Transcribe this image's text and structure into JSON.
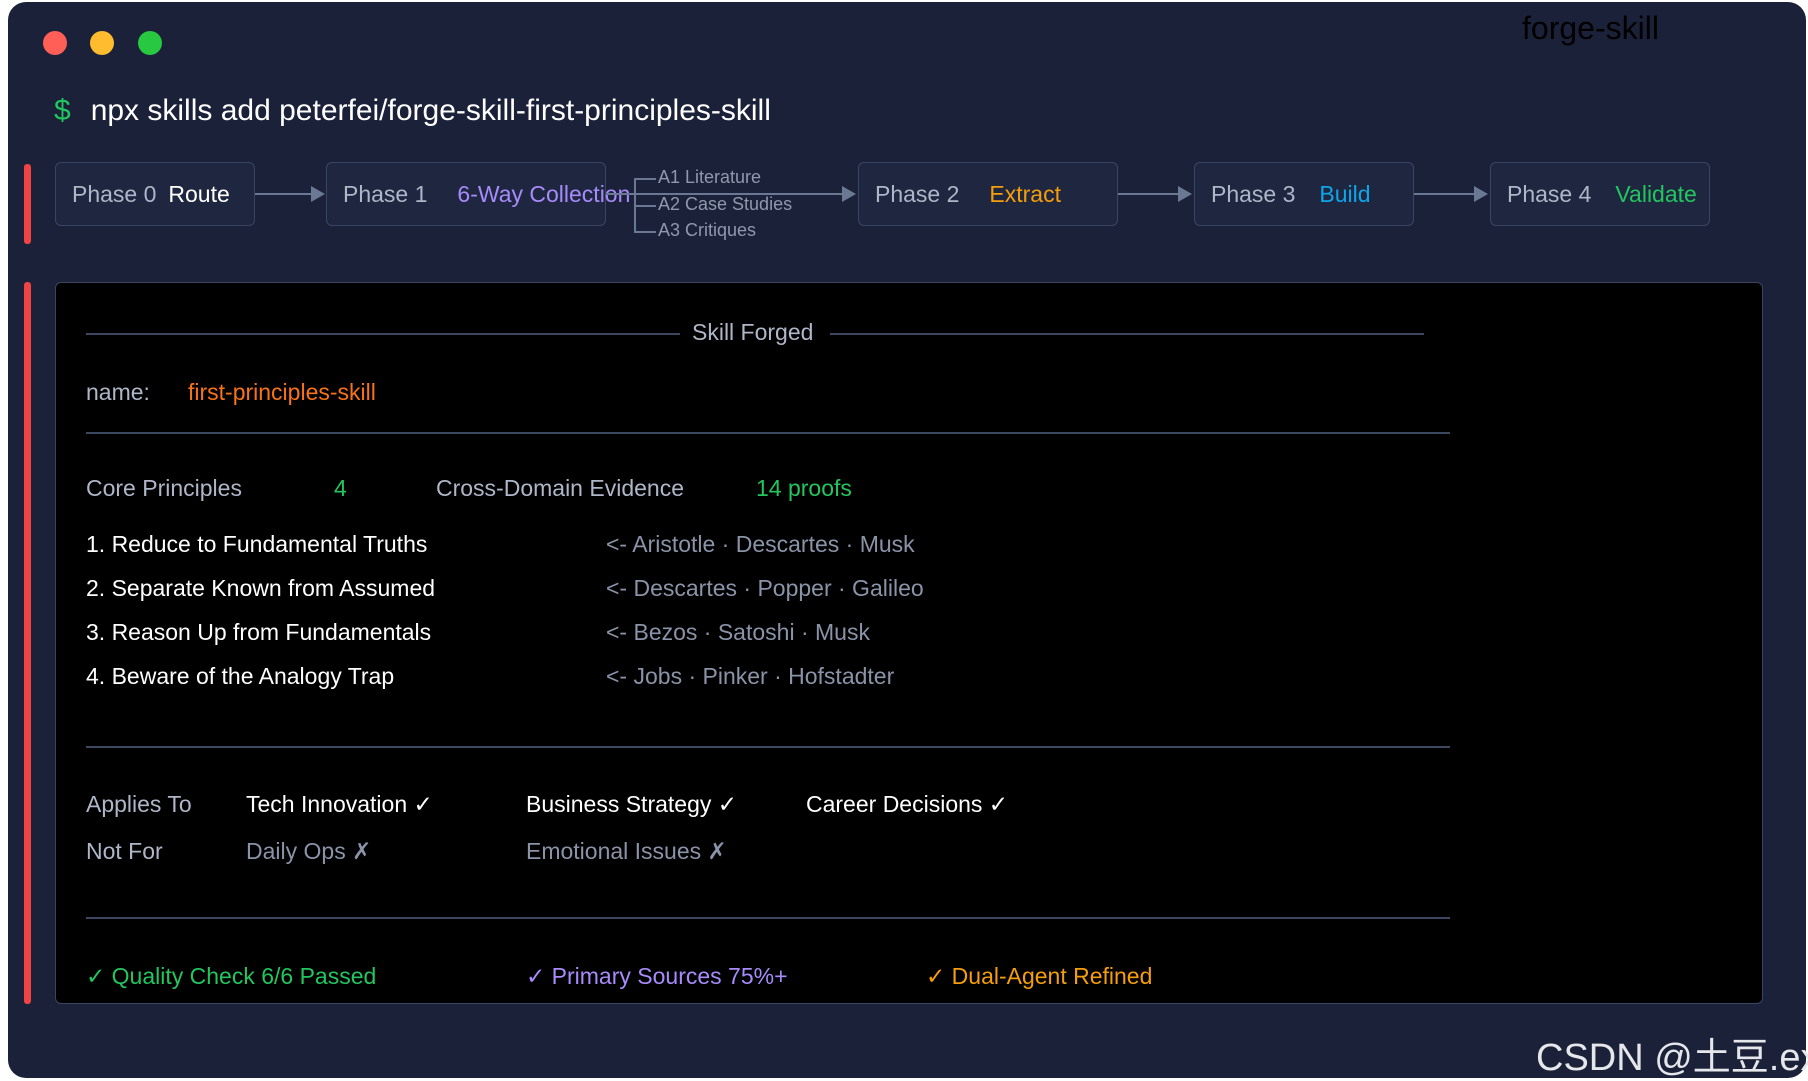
{
  "window": {
    "title": "forge-skill"
  },
  "command": {
    "prompt": "$",
    "text": "npx skills add peterfei/forge-skill-first-principles-skill"
  },
  "phases": [
    {
      "num": "Phase 0",
      "name": "Route",
      "color": "#ffffff"
    },
    {
      "num": "Phase 1",
      "name": "6-Way Collection",
      "color": "#a78bfa"
    },
    {
      "num": "Phase 2",
      "name": "Extract",
      "color": "#f59e0b"
    },
    {
      "num": "Phase 3",
      "name": "Build",
      "color": "#0ea5e9"
    },
    {
      "num": "Phase 4",
      "name": "Validate",
      "color": "#22c55e"
    }
  ],
  "branches": [
    "A1 Literature",
    "A2 Case Studies",
    "A3 Critiques"
  ],
  "result": {
    "header": "Skill Forged",
    "name_label": "name:",
    "name_value": "first-principles-skill",
    "core_label": "Core Principles",
    "core_value": "4",
    "evidence_label": "Cross-Domain Evidence",
    "evidence_value": "14 proofs",
    "principles": [
      {
        "text": "1. Reduce to Fundamental Truths",
        "sources": "<- Aristotle · Descartes · Musk"
      },
      {
        "text": "2. Separate Known from Assumed",
        "sources": "<- Descartes · Popper · Galileo"
      },
      {
        "text": "3. Reason Up from Fundamentals",
        "sources": "<- Bezos · Satoshi · Musk"
      },
      {
        "text": "4. Beware of the Analogy Trap",
        "sources": "<- Jobs · Pinker · Hofstadter"
      }
    ],
    "applies_label": "Applies To",
    "applies": [
      "Tech Innovation ✓",
      "Business Strategy ✓",
      "Career Decisions ✓"
    ],
    "notfor_label": "Not For",
    "notfor": [
      "Daily Ops ✗",
      "Emotional Issues ✗"
    ],
    "checks": [
      "✓ Quality Check 6/6 Passed",
      "✓ Primary Sources 75%+",
      "✓ Dual-Agent Refined"
    ]
  },
  "watermark": "CSDN @土豆.exe"
}
